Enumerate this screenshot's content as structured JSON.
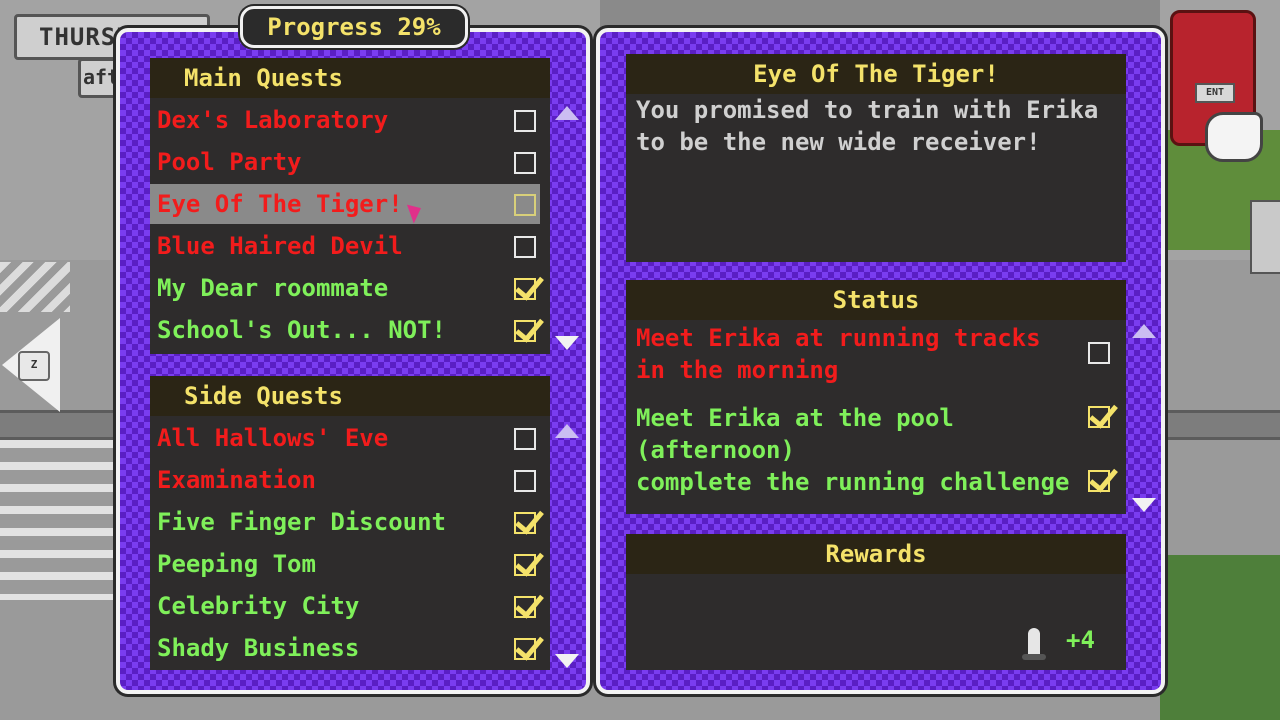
{
  "hud": {
    "day": "THURSDAY",
    "time": "aft",
    "back_key": "Z"
  },
  "progress": "Progress 29%",
  "main_quests": {
    "header": "Main Quests",
    "items": [
      {
        "label": "Dex's Laboratory",
        "status": "incomplete",
        "color": "#f21c1c"
      },
      {
        "label": "Pool Party",
        "status": "incomplete",
        "color": "#f21c1c"
      },
      {
        "label": "Eye Of The Tiger!",
        "status": "incomplete",
        "color": "#f21c1c",
        "selected": true
      },
      {
        "label": "Blue Haired Devil",
        "status": "incomplete",
        "color": "#f21c1c"
      },
      {
        "label": "My Dear roommate",
        "status": "complete",
        "color": "#7ff05a"
      },
      {
        "label": "School's Out... NOT!",
        "status": "complete",
        "color": "#7ff05a"
      }
    ]
  },
  "side_quests": {
    "header": "Side Quests",
    "items": [
      {
        "label": "All Hallows' Eve",
        "status": "incomplete",
        "color": "#f21c1c"
      },
      {
        "label": "Examination",
        "status": "incomplete",
        "color": "#f21c1c"
      },
      {
        "label": "Five Finger Discount",
        "status": "complete",
        "color": "#7ff05a"
      },
      {
        "label": "Peeping Tom",
        "status": "complete",
        "color": "#7ff05a"
      },
      {
        "label": "Celebrity City",
        "status": "complete",
        "color": "#7ff05a"
      },
      {
        "label": "Shady Business",
        "status": "complete",
        "color": "#7ff05a"
      }
    ]
  },
  "detail": {
    "title": "Eye Of The Tiger!",
    "description": "You promised to train with Erika to be the new wide receiver!",
    "status_header": "Status",
    "objectives": [
      {
        "text": "Meet Erika at running tracks in the morning",
        "status": "incomplete",
        "color": "#f21c1c"
      },
      {
        "text": "Meet Erika at the pool (afternoon)",
        "status": "complete",
        "color": "#7ff05a"
      },
      {
        "text": "complete the running challenge",
        "status": "complete",
        "color": "#7ff05a"
      }
    ],
    "rewards_header": "Rewards",
    "reward": {
      "icon": "trophy-icon",
      "value": "+4"
    }
  },
  "colors": {
    "incomplete": "#f21c1c",
    "complete": "#7ff05a",
    "header_text": "#f4e26a",
    "panel": "#5a1fc4"
  }
}
